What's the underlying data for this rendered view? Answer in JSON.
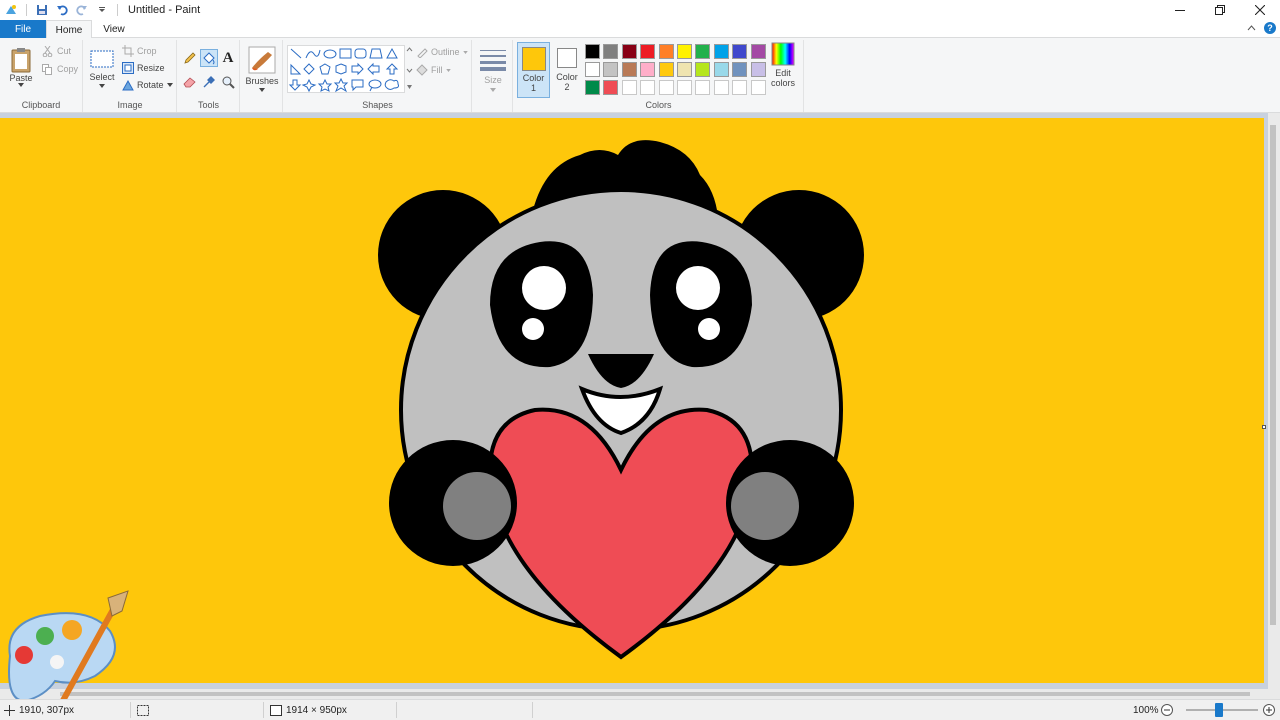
{
  "window": {
    "title": "Untitled - Paint"
  },
  "tabs": {
    "file": "File",
    "home": "Home",
    "view": "View"
  },
  "ribbon": {
    "clipboard": {
      "paste": "Paste",
      "cut": "Cut",
      "copy": "Copy",
      "label": "Clipboard"
    },
    "image": {
      "select": "Select",
      "crop": "Crop",
      "resize": "Resize",
      "rotate": "Rotate",
      "label": "Image"
    },
    "tools": {
      "label": "Tools",
      "text_glyph": "A"
    },
    "brushes": {
      "label": "Brushes"
    },
    "shapes": {
      "outline": "Outline",
      "fill": "Fill",
      "label": "Shapes"
    },
    "size": {
      "label": "Size"
    },
    "colors": {
      "color1_line1": "Color",
      "color1_line2": "1",
      "color2_line1": "Color",
      "color2_line2": "2",
      "edit_line1": "Edit",
      "edit_line2": "colors",
      "label": "Colors",
      "color1_value": "#fec70b",
      "color2_value": "#ffffff",
      "row1": [
        "#000000",
        "#7f7f7f",
        "#880015",
        "#ed1c24",
        "#ff7f27",
        "#fff200",
        "#22b14c",
        "#00a2e8",
        "#3f48cc",
        "#a349a4"
      ],
      "row2": [
        "#ffffff",
        "#c3c3c3",
        "#b97a57",
        "#ffaec9",
        "#ffc90e",
        "#efe4b0",
        "#b5e61d",
        "#99d9ea",
        "#7092be",
        "#c8bfe7"
      ],
      "row3": [
        "#008a4a",
        "#ef4c55"
      ]
    }
  },
  "canvas": {
    "background": "#fec70b"
  },
  "status": {
    "cursor_pos": "1910, 307px",
    "image_size": "1914 × 950px",
    "zoom": "100%"
  }
}
